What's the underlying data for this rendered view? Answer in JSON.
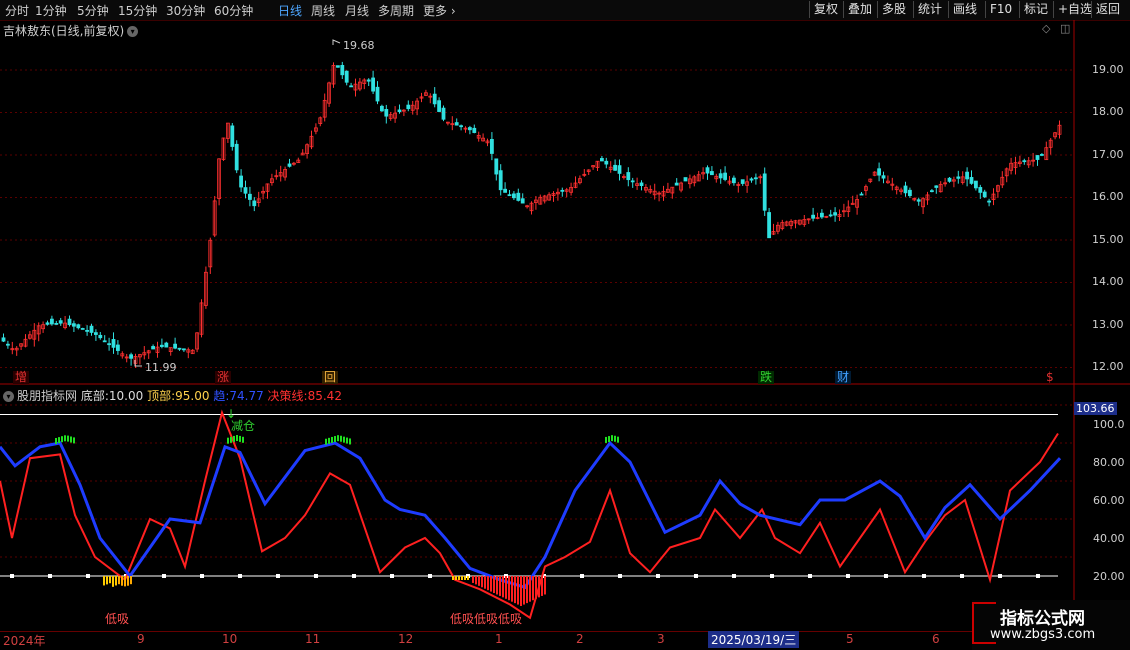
{
  "toolbar": {
    "periods": [
      "分时",
      "1分钟",
      "5分钟",
      "15分钟",
      "30分钟",
      "60分钟",
      "日线",
      "周线",
      "月线",
      "多周期",
      "更多"
    ],
    "active_period": "日线",
    "right_buttons": [
      "复权",
      "叠加",
      "多股",
      "统计",
      "画线",
      "F10",
      "标记",
      "+自选",
      "返回"
    ]
  },
  "stock": {
    "title": "吉林敖东(日线,前复权)"
  },
  "price_axis": [
    "19.00",
    "18.00",
    "17.00",
    "16.00",
    "15.00",
    "14.00",
    "13.00",
    "12.00"
  ],
  "price_marks": {
    "high": "19.68",
    "low": "11.99"
  },
  "event_badges": [
    {
      "text": "增",
      "color": "#e03030"
    },
    {
      "text": "涨",
      "color": "#e03030"
    },
    {
      "text": "回",
      "color": "#f0b040"
    },
    {
      "text": "跌",
      "color": "#30d030"
    },
    {
      "text": "财",
      "color": "#40a0ff"
    },
    {
      "text": "$",
      "color": "#e03030"
    }
  ],
  "indicator": {
    "name": "股朋指标网",
    "bottom_label": "底部:",
    "bottom_value": "10.00",
    "top_label": "顶部:",
    "top_value": "95.00",
    "trend_label": "趋:",
    "trend_value": "74.77",
    "decision_label": "决策线:",
    "decision_value": "85.42",
    "axis": [
      "100.0",
      "80.00",
      "60.00",
      "40.00",
      "20.00"
    ],
    "current_value": "103.66",
    "annotations": {
      "reduce": "减仓",
      "low_buy_1": "低吸",
      "low_buy_2": "低吸低吸低吸"
    }
  },
  "dates": {
    "labels": [
      "2024年",
      "9",
      "10",
      "11",
      "12",
      "1",
      "2",
      "3",
      "5",
      "6"
    ],
    "selected": "2025/03/19/三"
  },
  "watermark": {
    "line1": "指标公式网",
    "line2": "www.zbgs3.com"
  },
  "colors": {
    "up": "#ff3030",
    "down": "#30e0e0",
    "trend": "#1e3cff",
    "decision": "#ff2020",
    "grid": "#5a0000"
  },
  "chart_data": {
    "type": "candlestick",
    "price_ylim": [
      11.5,
      20.2
    ],
    "indicator_ylim": [
      0,
      100
    ],
    "bottom_level": 10,
    "top_level": 95,
    "high_label": 19.68,
    "low_label": 11.99
  }
}
